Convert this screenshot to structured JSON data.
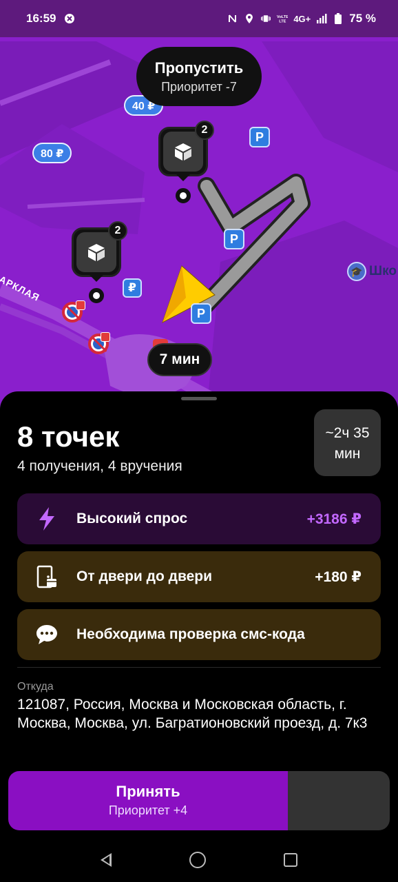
{
  "status_bar": {
    "time": "16:59",
    "battery": "75 %",
    "network": "4G+",
    "icons": [
      "app-notification-icon",
      "nfc-icon",
      "location-icon",
      "vibrate-icon",
      "volte-icon",
      "signal-icon",
      "battery-icon"
    ]
  },
  "map": {
    "skip": {
      "title": "Пропустить",
      "subtitle": "Приоритет -7"
    },
    "price_tags": [
      "40 ₽",
      "80 ₽"
    ],
    "parking_symbol": "P",
    "paid_parking_symbol": "₽",
    "markers": [
      {
        "count": "2"
      },
      {
        "count": "2"
      }
    ],
    "school_label": "Шко",
    "street_label": "БАРКЛАЯ",
    "eta": "7 мин",
    "colors": {
      "map": "#8a1fcc",
      "route": "#9a9a9a",
      "arrow": "#ffcc00"
    }
  },
  "order": {
    "title": "8 точек",
    "subtitle": "4 получения, 4 вручения",
    "duration": {
      "line1": "~2ч 35",
      "line2": "мин"
    },
    "cards": [
      {
        "icon": "lightning-icon",
        "label": "Высокий спрос",
        "value": "+3186 ₽"
      },
      {
        "icon": "door-box-icon",
        "label": "От двери до двери",
        "value": "+180 ₽"
      },
      {
        "icon": "chat-bubble-icon",
        "label": "Необходима проверка смс-кода",
        "value": ""
      }
    ],
    "from_label": "Откуда",
    "from_address": "121087, Россия, Москва и Московская область, г. Москва, Москва, ул. Багратионовский проезд, д. 7к3"
  },
  "actions": {
    "accept": {
      "title": "Принять",
      "subtitle": "Приоритет +4"
    }
  },
  "colors": {
    "accent": "#8a0fc2",
    "demand": "#c368ff",
    "demand_bg": "#2a0b36",
    "info_bg": "#3a2b0c"
  }
}
